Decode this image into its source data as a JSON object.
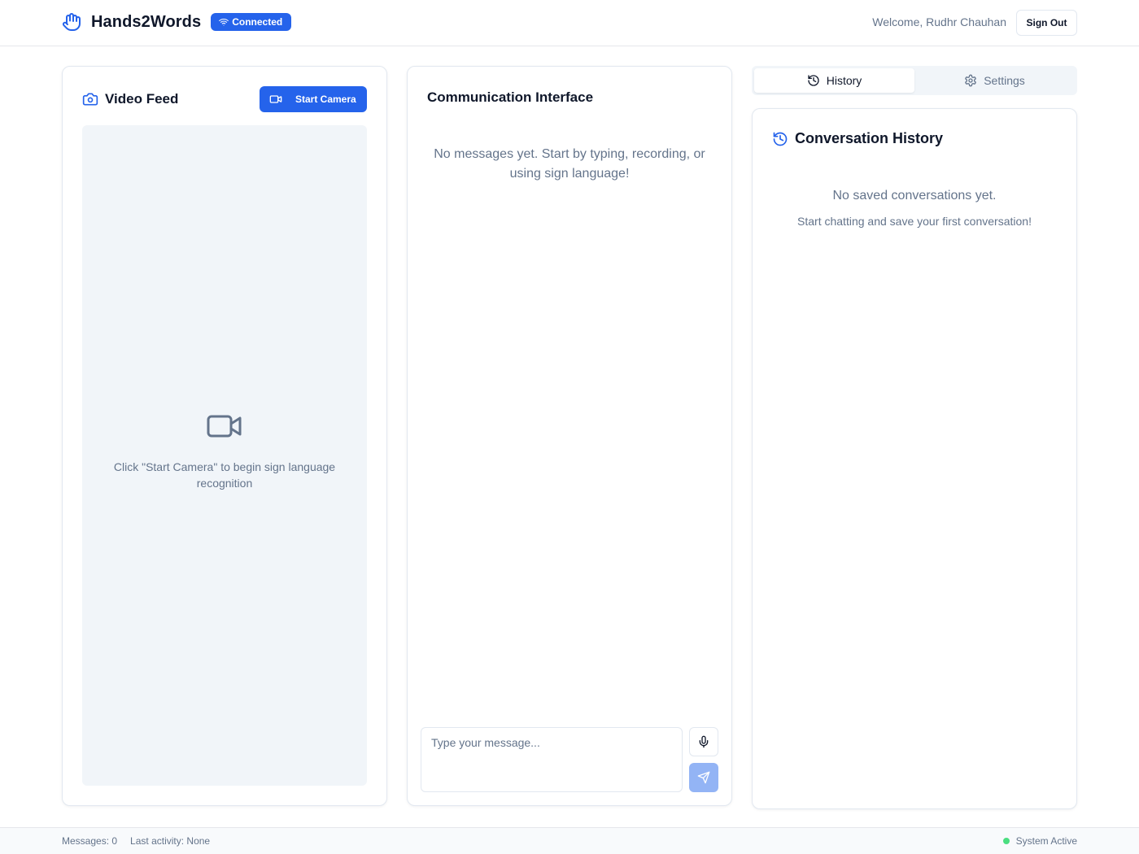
{
  "header": {
    "app_name": "Hands2Words",
    "status_badge": "Connected",
    "welcome_text": "Welcome, Rudhr Chauhan",
    "sign_out_label": "Sign Out"
  },
  "video_feed": {
    "title": "Video Feed",
    "start_camera_label": "Start Camera",
    "hint": "Click \"Start Camera\" to begin sign language recognition"
  },
  "communication": {
    "title": "Communication Interface",
    "empty_text": "No messages yet. Start by typing, recording, or using sign language!",
    "input_placeholder": "Type your message...",
    "input_value": ""
  },
  "tabs": [
    {
      "label": "History",
      "icon": "history-icon",
      "active": true
    },
    {
      "label": "Settings",
      "icon": "gear-icon",
      "active": false
    }
  ],
  "history": {
    "title": "Conversation History",
    "empty_text": "No saved conversations yet.",
    "empty_subtext": "Start chatting and save your first conversation!"
  },
  "footer": {
    "messages": "Messages: 0",
    "last_activity": "Last activity: None",
    "system_status": "System Active"
  },
  "colors": {
    "accent": "#2563eb",
    "send_disabled": "#93b4f5",
    "status_active": "#4ade80",
    "muted_text": "#64748b"
  }
}
